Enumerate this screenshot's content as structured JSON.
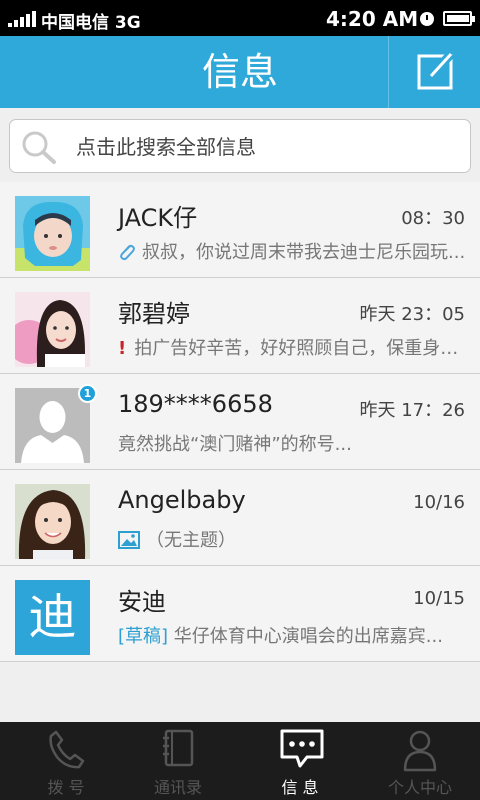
{
  "status": {
    "carrier": "中国电信 3G",
    "time": "4:20 AM"
  },
  "header": {
    "title": "信息"
  },
  "search": {
    "placeholder": "点击此搜索全部信息"
  },
  "messages": [
    {
      "name": "JACK仔",
      "time": "08：30",
      "snippet": "叔叔，你说过周末带我去迪士尼乐园玩...",
      "icon": "paperclip-icon"
    },
    {
      "name": "郭碧婷",
      "time": "昨天 23：05",
      "snippet": "拍广告好辛苦，好好照顾自己，保重身体...",
      "icon": "exclamation-icon",
      "flag": "!"
    },
    {
      "name": "189****6658",
      "time": "昨天 17：26",
      "snippet": "竟然挑战“澳门赌神”的称号...",
      "badge": "1"
    },
    {
      "name": "Angelbaby",
      "time": "10/16",
      "snippet": "（无主题）",
      "icon": "image-icon"
    },
    {
      "name": "安迪",
      "time": "10/15",
      "draft": "[草稿]",
      "snippet": "华仔体育中心演唱会的出席嘉宾...",
      "avatar_text": "迪"
    }
  ],
  "tabs": [
    {
      "label": "拨 号",
      "icon": "phone-icon"
    },
    {
      "label": "通讯录",
      "icon": "contacts-book-icon"
    },
    {
      "label": "信 息",
      "icon": "message-bubble-icon",
      "active": true
    },
    {
      "label": "个人中心",
      "icon": "person-icon"
    }
  ],
  "colors": {
    "accent": "#2fa9d9",
    "tab_bar": "#1c1c1c",
    "badge": "#1ea0db"
  }
}
